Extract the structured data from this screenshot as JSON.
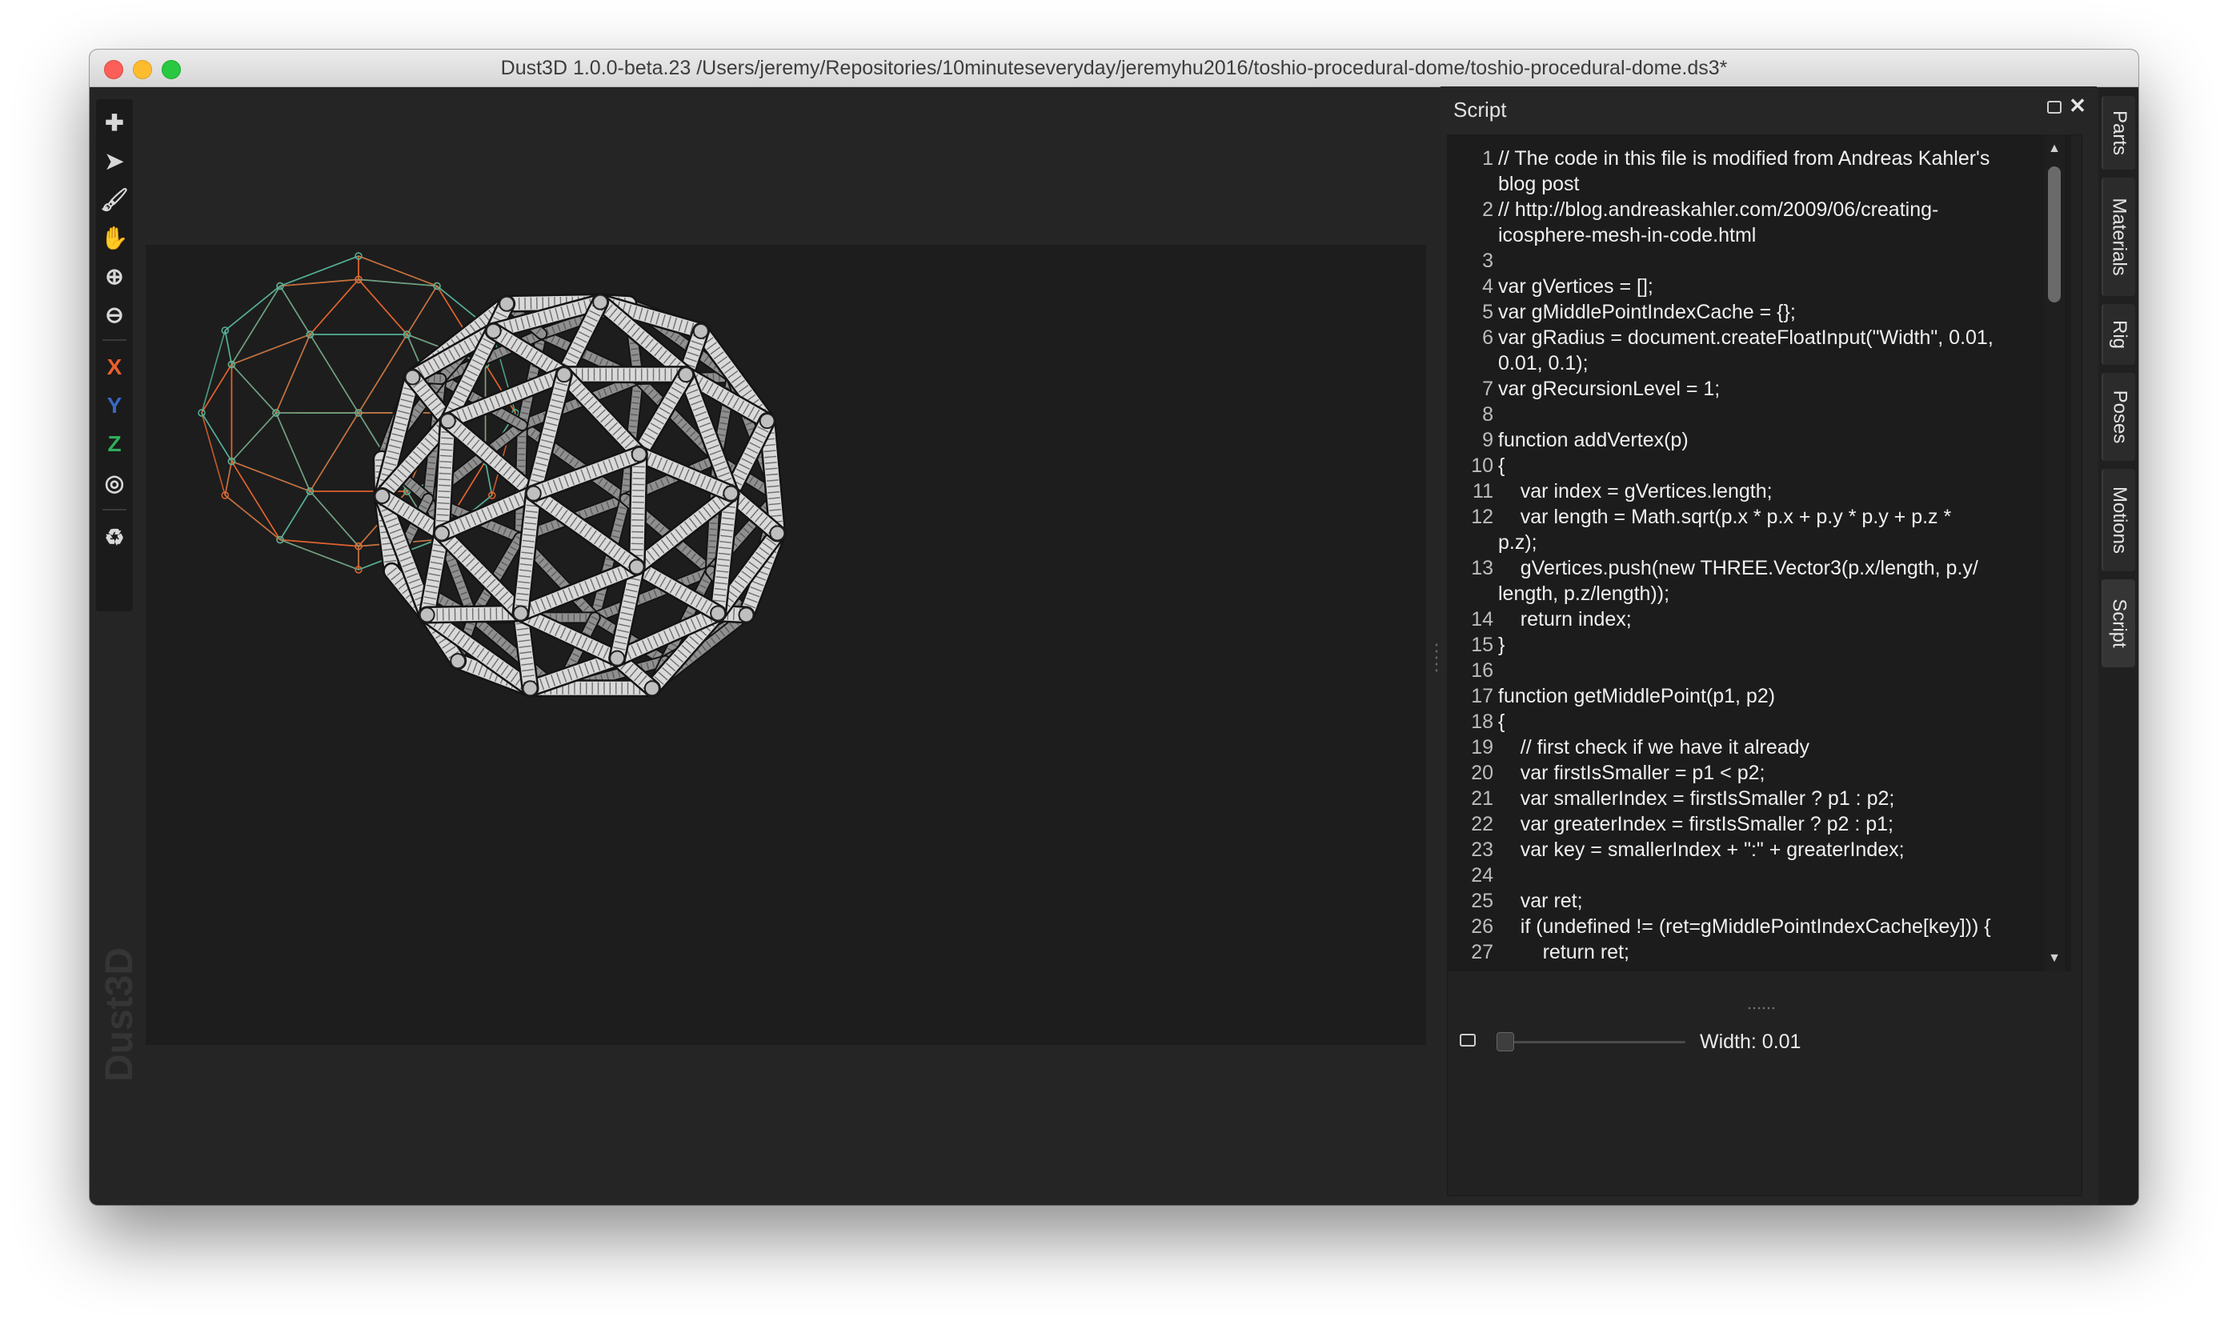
{
  "window": {
    "title": "Dust3D 1.0.0-beta.23 /Users/jeremy/Repositories/10minuteseveryday/jeremyhu2016/toshio-procedural-dome/toshio-procedural-dome.ds3*"
  },
  "toolbar": {
    "items": [
      {
        "name": "add-icon",
        "glyph": "✚"
      },
      {
        "name": "select-arrow-icon",
        "glyph": "➤"
      },
      {
        "name": "paint-brush-icon",
        "glyph": "🖌"
      },
      {
        "name": "hand-icon",
        "glyph": "✋"
      },
      {
        "name": "zoom-in-icon",
        "glyph": "⊕"
      },
      {
        "name": "zoom-out-icon",
        "glyph": "⊖"
      }
    ],
    "axes": {
      "x": "X",
      "y": "Y",
      "z": "Z"
    },
    "radial_glyph": "◎",
    "regenerate_glyph": "♻"
  },
  "watermark": "Dust3D",
  "script_panel": {
    "title": "Script",
    "close_glyph": "✕",
    "lines": [
      {
        "n": "1",
        "text": "// The code in this file is modified from Andreas Kahler's"
      },
      {
        "n": "",
        "text": "blog post"
      },
      {
        "n": "2",
        "text": "// http://blog.andreaskahler.com/2009/06/creating-"
      },
      {
        "n": "",
        "text": "icosphere-mesh-in-code.html"
      },
      {
        "n": "3",
        "text": ""
      },
      {
        "n": "4",
        "text": "var gVertices = [];"
      },
      {
        "n": "5",
        "text": "var gMiddlePointIndexCache = {};"
      },
      {
        "n": "6",
        "text": "var gRadius = document.createFloatInput(\"Width\", 0.01,"
      },
      {
        "n": "",
        "text": "0.01, 0.1);"
      },
      {
        "n": "7",
        "text": "var gRecursionLevel = 1;"
      },
      {
        "n": "8",
        "text": ""
      },
      {
        "n": "9",
        "text": "function addVertex(p)"
      },
      {
        "n": "10",
        "text": "{"
      },
      {
        "n": "11",
        "text": "    var index = gVertices.length;"
      },
      {
        "n": "12",
        "text": "    var length = Math.sqrt(p.x * p.x + p.y * p.y + p.z *"
      },
      {
        "n": "",
        "text": "p.z);"
      },
      {
        "n": "13",
        "text": "    gVertices.push(new THREE.Vector3(p.x/length, p.y/"
      },
      {
        "n": "",
        "text": "length, p.z/length));"
      },
      {
        "n": "14",
        "text": "    return index;"
      },
      {
        "n": "15",
        "text": "}"
      },
      {
        "n": "16",
        "text": ""
      },
      {
        "n": "17",
        "text": "function getMiddlePoint(p1, p2)"
      },
      {
        "n": "18",
        "text": "{"
      },
      {
        "n": "19",
        "text": "    // first check if we have it already"
      },
      {
        "n": "20",
        "text": "    var firstIsSmaller = p1 < p2;"
      },
      {
        "n": "21",
        "text": "    var smallerIndex = firstIsSmaller ? p1 : p2;"
      },
      {
        "n": "22",
        "text": "    var greaterIndex = firstIsSmaller ? p2 : p1;"
      },
      {
        "n": "23",
        "text": "    var key = smallerIndex + \":\" + greaterIndex;"
      },
      {
        "n": "24",
        "text": ""
      },
      {
        "n": "25",
        "text": "    var ret;"
      },
      {
        "n": "26",
        "text": "    if (undefined != (ret=gMiddlePointIndexCache[key])) {"
      },
      {
        "n": "27",
        "text": "        return ret;"
      }
    ],
    "highlighted_source_line": "6",
    "scroll_fraction": 0.0,
    "parameter": {
      "label": "Width: 0.01",
      "value": 0.01,
      "min": 0.01,
      "max": 0.1
    }
  },
  "right_tabs": [
    "Parts",
    "Materials",
    "Rig",
    "Poses",
    "Motions",
    "Script"
  ],
  "active_tab": "Script",
  "colors": {
    "background": "#252525",
    "viewport": "#1d1d1d",
    "wire_orange": "#e5652d",
    "wire_teal": "#57b39a",
    "mesh_light": "#d9d9d9",
    "mesh_dark": "#4b4b4b"
  }
}
